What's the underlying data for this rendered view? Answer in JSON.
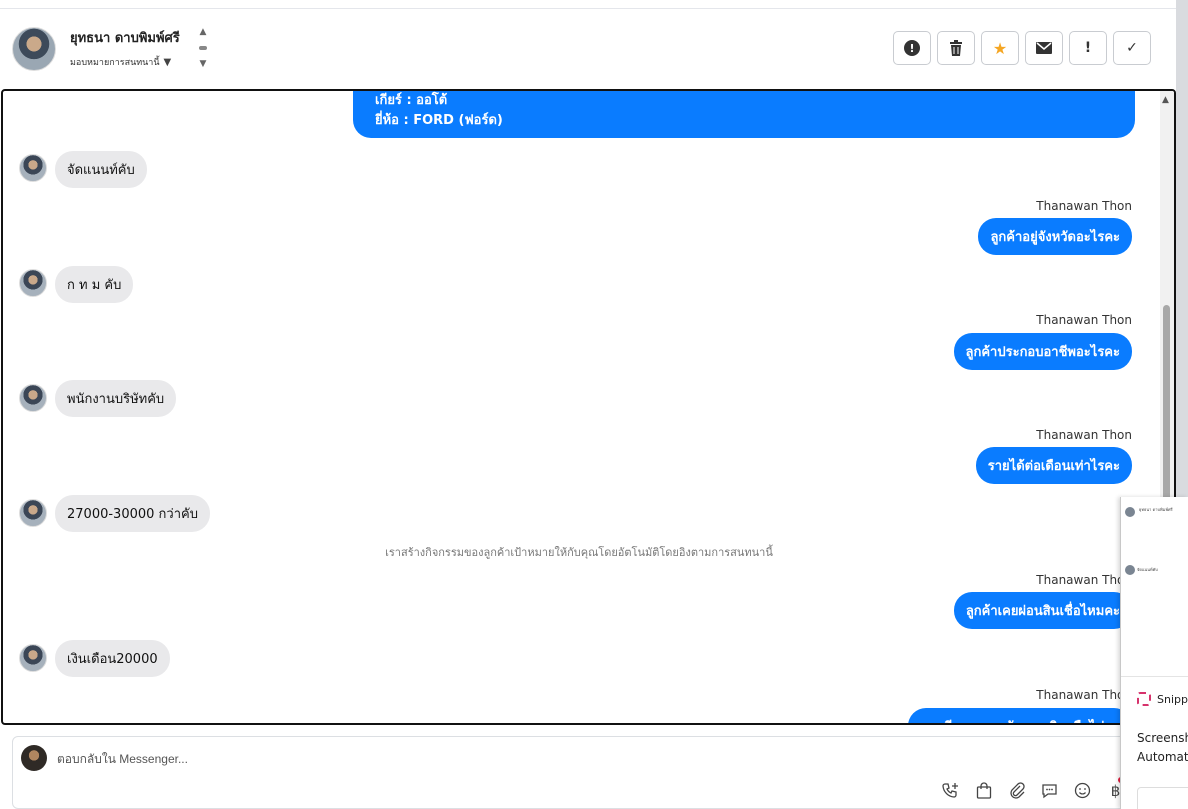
{
  "header": {
    "contact_name": "ยุทธนา ดาบพิมพ์ศรี",
    "assign_label": "มอบหมายการสนทนานี้",
    "actions": [
      {
        "name": "report-button",
        "icon": "exclamation-circle-icon"
      },
      {
        "name": "delete-button",
        "icon": "trash-icon"
      },
      {
        "name": "star-button",
        "icon": "star-icon"
      },
      {
        "name": "mail-button",
        "icon": "envelope-icon"
      },
      {
        "name": "important-button",
        "icon": "exclamation-icon",
        "label": "!"
      },
      {
        "name": "done-button",
        "icon": "check-icon",
        "label": "✓"
      }
    ]
  },
  "conversation": {
    "top_bubble_lines": [
      "เกียร์ : ออโต้",
      "ยี่ห้อ : FORD (ฟอร์ด)"
    ],
    "messages": [
      {
        "dir": "in",
        "text": "จัดแนนท์คับ"
      },
      {
        "dir": "out",
        "sender": "Thanawan Thon",
        "text": "ลูกค้าอยู่จังหวัดอะไรคะ"
      },
      {
        "dir": "in",
        "text": "ก ท ม คับ"
      },
      {
        "dir": "out",
        "sender": "Thanawan Thon",
        "text": "ลูกค้าประกอบอาชีพอะไรคะ"
      },
      {
        "dir": "in",
        "text": "พนักงานบริษัทคับ"
      },
      {
        "dir": "out",
        "sender": "Thanawan Thon",
        "text": "รายได้ต่อเดือนเท่าไรคะ"
      },
      {
        "dir": "in",
        "text": "27000-30000 กว่าคับ"
      },
      {
        "dir": "system",
        "text": "เราสร้างกิจกรรมของลูกค้าเป้าหมายให้กับคุณโดยอัตโนมัติโดยอิงตามการสนทนานี้"
      },
      {
        "dir": "out",
        "sender": "Thanawan Thon",
        "text": "ลูกค้าเคยผ่อนสินเชื่อไหมคะ"
      },
      {
        "dir": "in",
        "text": "เงินเดือน20000"
      },
      {
        "dir": "out",
        "sender": "Thanawan Thon",
        "text": "และมีภาระของบัตรเครดิตหรือไม่คะ"
      }
    ]
  },
  "composer": {
    "placeholder": "ตอบกลับใน Messenger...",
    "tools": [
      "phone-plus-icon",
      "shopping-bag-icon",
      "paperclip-icon",
      "chat-bubble-icon",
      "smiley-icon",
      "baht-icon"
    ],
    "baht_symbol": "฿"
  },
  "snip_panel": {
    "app_name": "Snipping Tool",
    "line1": "Screenshot",
    "line2": "Automatically",
    "mini_text_a": "ยุทธนา ดาบพิมพ์ศรี",
    "mini_text_b": "จัดแนนท์คับ"
  },
  "colors": {
    "outgoing_bubble": "#0a7cff",
    "incoming_bubble": "#e9e9eb",
    "star": "#f5a623"
  }
}
